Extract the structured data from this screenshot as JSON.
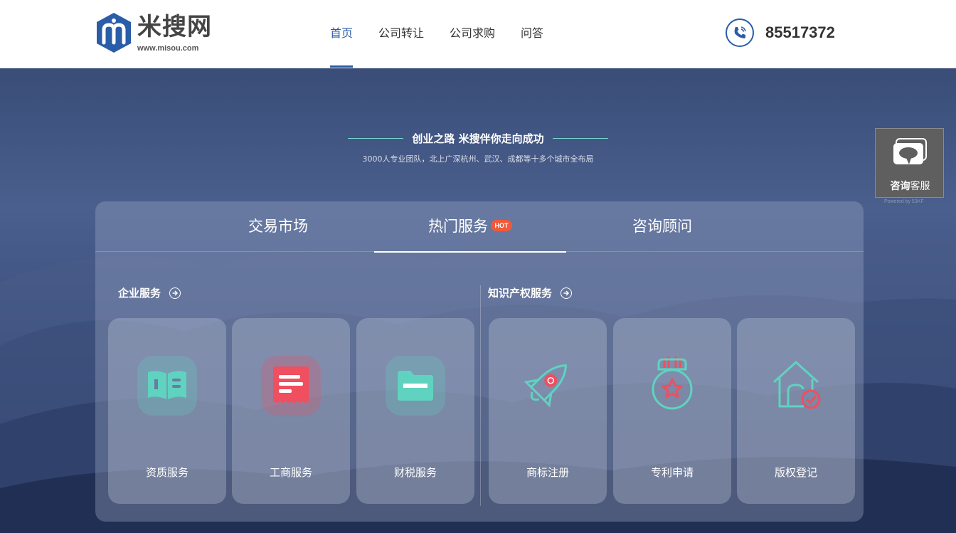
{
  "header": {
    "logo_text": "米搜网",
    "logo_url": "www.misou.com",
    "nav": [
      "首页",
      "公司转让",
      "公司求购",
      "问答"
    ],
    "phone": "85517372"
  },
  "hero": {
    "slogan": "创业之路 米搜伴你走向成功",
    "sub_slogan": "3000人专业团队，北上广深杭州、武汉、成都等十多个城市全布局"
  },
  "consult": {
    "label_bold": "咨询",
    "label_rest": "客服",
    "powered": "Powered by 53KF"
  },
  "panel": {
    "tabs": [
      "交易市场",
      "热门服务",
      "咨询顾问"
    ],
    "hot_badge": "HOT",
    "sections": [
      "企业服务",
      "知识产权服务"
    ],
    "cards": [
      "资质服务",
      "工商服务",
      "财税服务",
      "商标注册",
      "专利申请",
      "版权登记"
    ]
  },
  "colors": {
    "brand_blue": "#2a5da8",
    "teal": "#5fd3c0",
    "red": "#ef4f5f",
    "hot": "#f05a3a"
  },
  "icons": [
    "phone-icon",
    "book-icon",
    "document-icon",
    "folder-icon",
    "rocket-icon",
    "medal-icon",
    "house-check-icon",
    "chat-icon",
    "arrow-right-icon"
  ]
}
